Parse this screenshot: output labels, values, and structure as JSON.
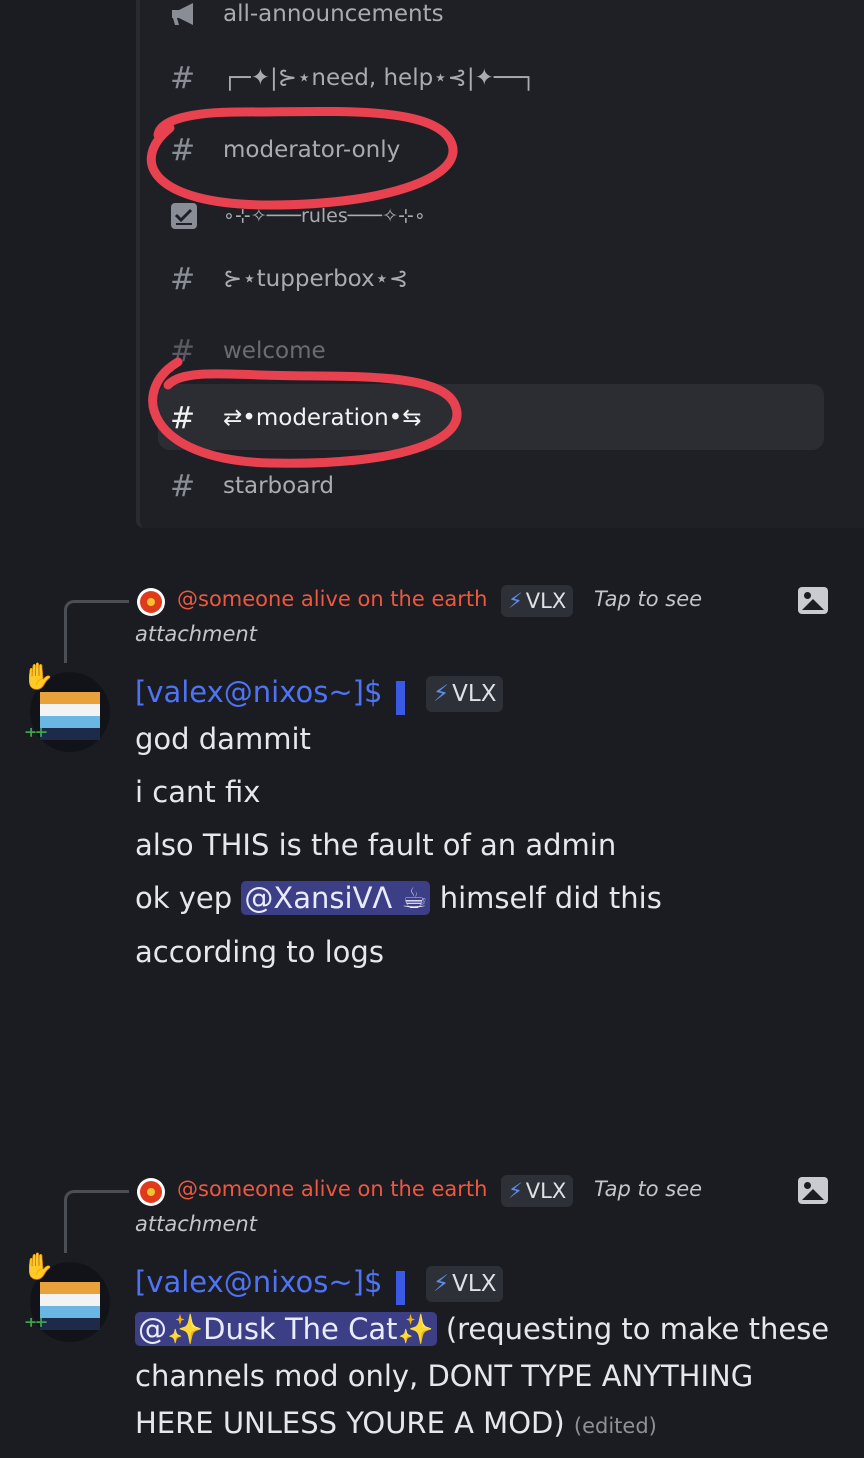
{
  "channels": [
    {
      "name": "all-announcements",
      "icon": "megaphone-icon"
    },
    {
      "name": "┌─✦|⊱⋆need, help⋆⊰|✦──┐",
      "icon": "hash-icon"
    },
    {
      "name": "moderator-only",
      "icon": "hash-icon"
    },
    {
      "name": "∘⊹✧───rules───✧⊹∘",
      "icon": "checklist-icon"
    },
    {
      "name": "⊱⋆tupperbox⋆⊰",
      "icon": "hash-icon"
    },
    {
      "name": "welcome",
      "icon": "hash-icon"
    },
    {
      "name": "⇄•moderation•⇆",
      "icon": "hash-icon"
    },
    {
      "name": "starboard",
      "icon": "hash-icon"
    }
  ],
  "hash_glyph": "#",
  "annotation_color": "#e8414f",
  "messages": [
    {
      "reply": {
        "name": "@someone alive on the earth",
        "tag": "VLX",
        "text1": "Tap to see",
        "text2": "attachment"
      },
      "author": "[valex@nixos~]$",
      "tag": "VLX",
      "lines": {
        "l1": "god dammit",
        "l2": "i cant fix",
        "l3": "also THIS is the fault of an admin",
        "l4_pre": "ok yep",
        "l4_mention": "@XansiVΛ ☕",
        "l4_post": "himself did this",
        "l5": "according to logs"
      }
    },
    {
      "reply": {
        "name": "@someone alive on the earth",
        "tag": "VLX",
        "text1": "Tap to see",
        "text2": "attachment"
      },
      "author": "[valex@nixos~]$",
      "tag": "VLX",
      "lines": {
        "mention": "@✨Dusk The Cat✨",
        "l1_post": "(requesting to make these",
        "l2": "channels mod only, DONT TYPE ANYTHING",
        "l3": "HERE UNLESS YOURE A MOD)",
        "edited": "(edited)"
      }
    }
  ],
  "bolt_glyph": "⚡"
}
